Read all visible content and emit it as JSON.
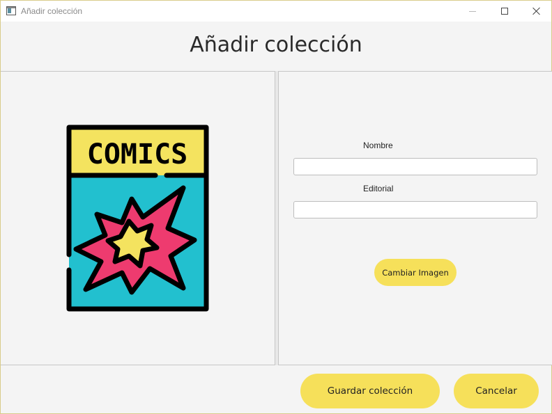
{
  "window": {
    "title": "Añadir colección",
    "controls": {
      "minimize": "minimize",
      "maximize": "maximize",
      "close": "close"
    }
  },
  "header": {
    "title": "Añadir colección"
  },
  "image": {
    "caption": "COMICS",
    "icon": "comic-book-icon"
  },
  "form": {
    "nombre_label": "Nombre",
    "nombre_value": "",
    "editorial_label": "Editorial",
    "editorial_value": "",
    "change_image_label": "Cambiar Imagen"
  },
  "footer": {
    "save_label": "Guardar colección",
    "cancel_label": "Cancelar"
  },
  "colors": {
    "accent": "#f6e05a",
    "comic_yellow": "#f4e35f",
    "comic_teal": "#22c0cf",
    "comic_pink": "#ee3b6f"
  }
}
